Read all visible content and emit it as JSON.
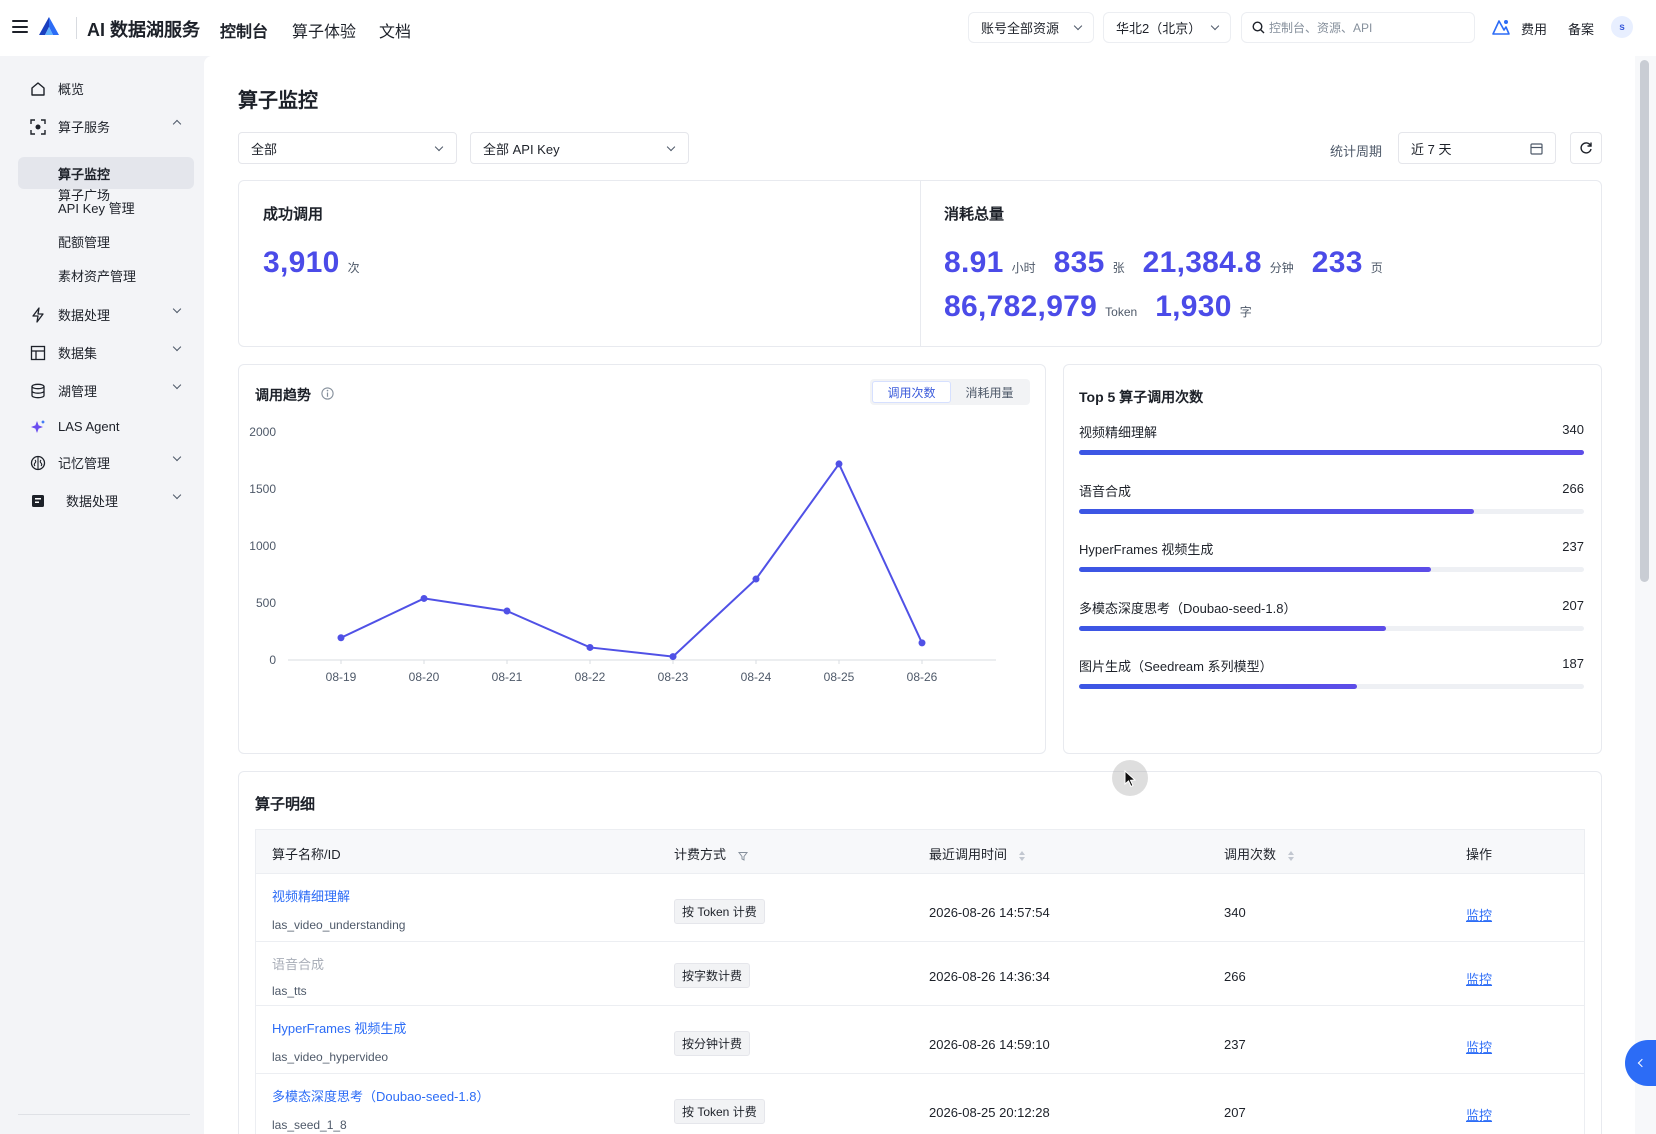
{
  "header": {
    "brand": "AI 数据湖服务",
    "nav": [
      "控制台",
      "算子体验",
      "文档"
    ],
    "account_scope": "账号全部资源",
    "region": "华北2（北京）",
    "search_placeholder": "控制台、资源、API",
    "links": [
      "费用",
      "备案"
    ],
    "avatar": "s"
  },
  "sidebar": {
    "items": [
      {
        "label": "概览",
        "icon": "home-icon"
      },
      {
        "label": "算子服务",
        "icon": "operator-icon",
        "expanded": true,
        "children": [
          "算子广场",
          "算子监控",
          "API Key 管理",
          "配额管理",
          "素材资产管理"
        ]
      },
      {
        "label": "数据处理",
        "icon": "lightning-icon"
      },
      {
        "label": "数据集",
        "icon": "table-icon"
      },
      {
        "label": "湖管理",
        "icon": "database-icon"
      },
      {
        "label": "LAS Agent",
        "icon": "sparkle-icon"
      },
      {
        "label": "记忆管理",
        "icon": "brain-icon"
      },
      {
        "label": "数据处理",
        "icon": "book-icon"
      }
    ],
    "active": "算子监控"
  },
  "page": {
    "title": "算子监控",
    "filter_operator": "全部",
    "filter_apikey": "全部 API Key",
    "period_label": "统计周期",
    "period_value": "近 7 天"
  },
  "summary": {
    "success_title": "成功调用",
    "success_value": "3,910",
    "success_unit": "次",
    "consumption_title": "消耗总量",
    "consumption": [
      {
        "value": "8.91",
        "unit": "小时"
      },
      {
        "value": "835",
        "unit": "张"
      },
      {
        "value": "21,384.8",
        "unit": "分钟"
      },
      {
        "value": "233",
        "unit": "页"
      },
      {
        "value": "86,782,979",
        "unit": "Token"
      },
      {
        "value": "1,930",
        "unit": "字"
      }
    ]
  },
  "trend": {
    "title": "调用趋势",
    "tabs": [
      "调用次数",
      "消耗用量"
    ],
    "active_tab": "调用次数"
  },
  "chart_data": {
    "type": "line",
    "title": "调用趋势",
    "x": [
      "08-19",
      "08-20",
      "08-21",
      "08-22",
      "08-23",
      "08-24",
      "08-25",
      "08-26"
    ],
    "series": [
      {
        "values": [
          195,
          540,
          430,
          110,
          30,
          710,
          1720,
          150
        ]
      }
    ],
    "ylim": [
      0,
      2000
    ],
    "yticks": [
      0,
      500,
      1000,
      1500,
      2000
    ],
    "grid": false,
    "color": "#5051e6"
  },
  "top5": {
    "title": "Top 5 算子调用次数",
    "max": 340,
    "items": [
      {
        "name": "视频精细理解",
        "value": 340
      },
      {
        "name": "语音合成",
        "value": 266
      },
      {
        "name": "HyperFrames 视频生成",
        "value": 237
      },
      {
        "name": "多模态深度思考（Doubao-seed-1.8）",
        "value": 207
      },
      {
        "name": "图片生成（Seedream 系列模型）",
        "value": 187
      }
    ]
  },
  "detail": {
    "title": "算子明细",
    "columns": [
      "算子名称/ID",
      "计费方式",
      "最近调用时间",
      "调用次数",
      "操作"
    ],
    "rows": [
      {
        "name": "视频精细理解",
        "id": "las_video_understanding",
        "billing": "按 Token 计费",
        "time": "2026-08-26 14:57:54",
        "count": "340",
        "action": "监控",
        "disabled": false
      },
      {
        "name": "语音合成",
        "id": "las_tts",
        "billing": "按字数计费",
        "time": "2026-08-26 14:36:34",
        "count": "266",
        "action": "监控",
        "disabled": true
      },
      {
        "name": "HyperFrames 视频生成",
        "id": "las_video_hypervideo",
        "billing": "按分钟计费",
        "time": "2026-08-26 14:59:10",
        "count": "237",
        "action": "监控",
        "disabled": false
      },
      {
        "name": "多模态深度思考（Doubao-seed-1.8）",
        "id": "las_seed_1_8",
        "billing": "按 Token 计费",
        "time": "2026-08-25 20:12:28",
        "count": "207",
        "action": "监控",
        "disabled": false
      }
    ]
  }
}
